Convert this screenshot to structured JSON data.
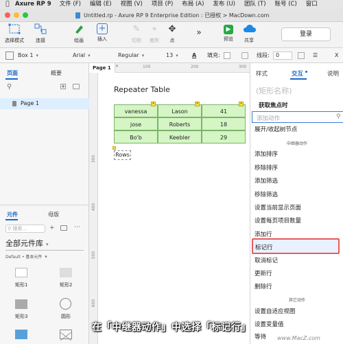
{
  "menubar": {
    "app": "Axure RP 9",
    "items": [
      "文件 (F)",
      "编辑 (E)",
      "视图 (V)",
      "项目 (P)",
      "布局 (A)",
      "发布 (U)",
      "团队 (T)",
      "账号 (C)",
      "窗口"
    ]
  },
  "window": {
    "title": "Untitled.rp - Axure RP 9 Enterprise Edition : 已授权 > MacDown.com"
  },
  "toolbar": {
    "select_mode": "选择模式",
    "connect": "连接",
    "draw": "绘画",
    "insert": "插入",
    "crop": "切割",
    "cut": "裁剪",
    "point": "点",
    "preview": "预览",
    "share": "共享",
    "login": "登录"
  },
  "stylebar": {
    "widget": "Box 1",
    "font": "Arial",
    "weight": "Regular",
    "size": "13",
    "fill_label": "填充:",
    "line_label": "线段:",
    "line_value": "0",
    "x_label": "X"
  },
  "left": {
    "tabs": [
      "页面",
      "概要"
    ],
    "page_item": "Page 1",
    "lib_tabs": [
      "元件",
      "母版"
    ],
    "search_placeholder": "搜索...",
    "library_title": "全部元件库",
    "library_sub": "Default • 基本元件",
    "widgets": [
      "矩形1",
      "矩形2",
      "矩形3",
      "圆形"
    ]
  },
  "canvas": {
    "page_tab": "Page 1",
    "ruler_h": [
      "100",
      "200",
      "300"
    ],
    "ruler_v": [
      "300",
      "400",
      "500",
      "600"
    ],
    "heading": "Repeater Table",
    "rows": [
      [
        "vanessa",
        "Lason",
        "41"
      ],
      [
        "jose",
        "Roberts",
        "18"
      ],
      [
        "Bo'b",
        "Keebler",
        "29"
      ]
    ],
    "rows_label": "Rows"
  },
  "right": {
    "tabs": [
      "样式",
      "交互",
      "说明"
    ],
    "shape_name": "(矩形名称)",
    "event": "获取焦点时",
    "search_placeholder": "添加动作",
    "first_item": "展开/收起树节点",
    "section_repeater": "中继器动作",
    "items": [
      "添加排序",
      "移除排序",
      "添加筛选",
      "移除筛选",
      "设置当前显示页面",
      "设置每页项目数量",
      "添加行",
      "标记行",
      "取消标记",
      "更新行",
      "删除行"
    ],
    "section_other": "其它动作",
    "other_items": [
      "设置自适应视图",
      "设置变量值",
      "等待"
    ]
  },
  "caption": "在「中继器动作」中选择「标记行」",
  "watermark": "www.MacZ.com"
}
